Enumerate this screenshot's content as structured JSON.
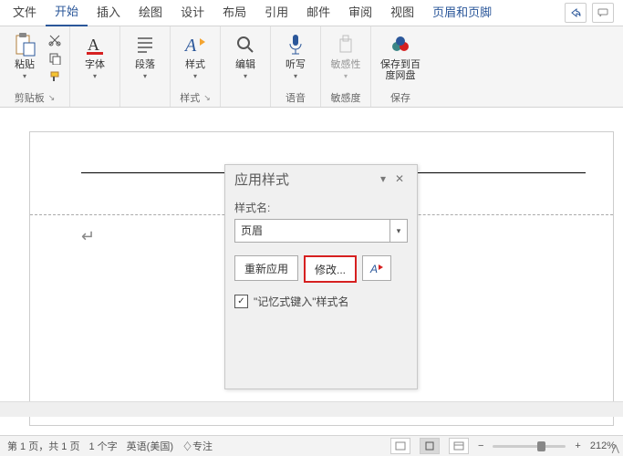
{
  "tabs": [
    "文件",
    "开始",
    "插入",
    "绘图",
    "设计",
    "布局",
    "引用",
    "邮件",
    "审阅",
    "视图",
    "页眉和页脚"
  ],
  "ribbon": {
    "clipboard": {
      "paste": "粘贴",
      "label": "剪贴板"
    },
    "font": {
      "label": "字体"
    },
    "paragraph": {
      "label": "段落"
    },
    "styles": {
      "button": "样式",
      "label": "样式"
    },
    "editing": {
      "label": "编辑"
    },
    "voice": {
      "button": "听写",
      "label": "语音"
    },
    "sensitivity": {
      "button": "敏感性",
      "label": "敏感度"
    },
    "save": {
      "button": "保存到百度网盘",
      "label": "保存"
    }
  },
  "pane": {
    "title": "应用样式",
    "style_name_label": "样式名:",
    "style_value": "页眉",
    "reapply": "重新应用",
    "modify": "修改...",
    "autocomplete": "\"记忆式键入\"样式名"
  },
  "status": {
    "pages": "第 1 页，共 1 页",
    "words": "1 个字",
    "language": "英语(美国)",
    "focus": "♢专注",
    "zoom": "212%"
  }
}
